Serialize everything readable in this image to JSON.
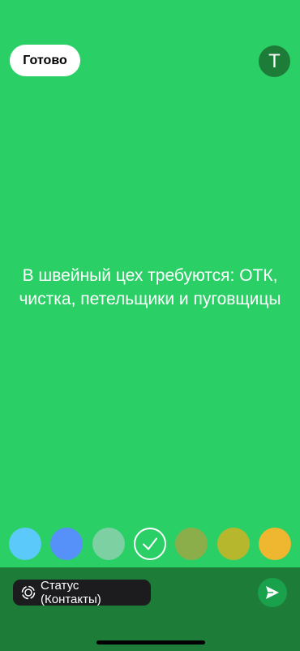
{
  "colors": {
    "background": "#2ad066",
    "bottom_bar": "#1e7c39",
    "text_tool_circle": "#1e7c39",
    "send_button": "#19a14b"
  },
  "header": {
    "done_label": "Готово",
    "text_tool_label": "T"
  },
  "status": {
    "text": "В швейный цех требуются: ОТК, чистка, петельщики и пуговщицы"
  },
  "palette": {
    "swatches": [
      {
        "color": "#5bc9fa",
        "selected": false
      },
      {
        "color": "#5591f8",
        "selected": false
      },
      {
        "color": "#7dd0a2",
        "selected": false
      },
      {
        "color": "#2ad066",
        "selected": true
      },
      {
        "color": "#8bae4a",
        "selected": false
      },
      {
        "color": "#b6b72d",
        "selected": false
      },
      {
        "color": "#eeb72f",
        "selected": false
      }
    ],
    "selected_icon": "checkmark-icon"
  },
  "footer": {
    "audience_label": "Статус (Контакты)",
    "audience_icon": "status-ring-icon",
    "send_icon": "send-arrow-icon"
  }
}
